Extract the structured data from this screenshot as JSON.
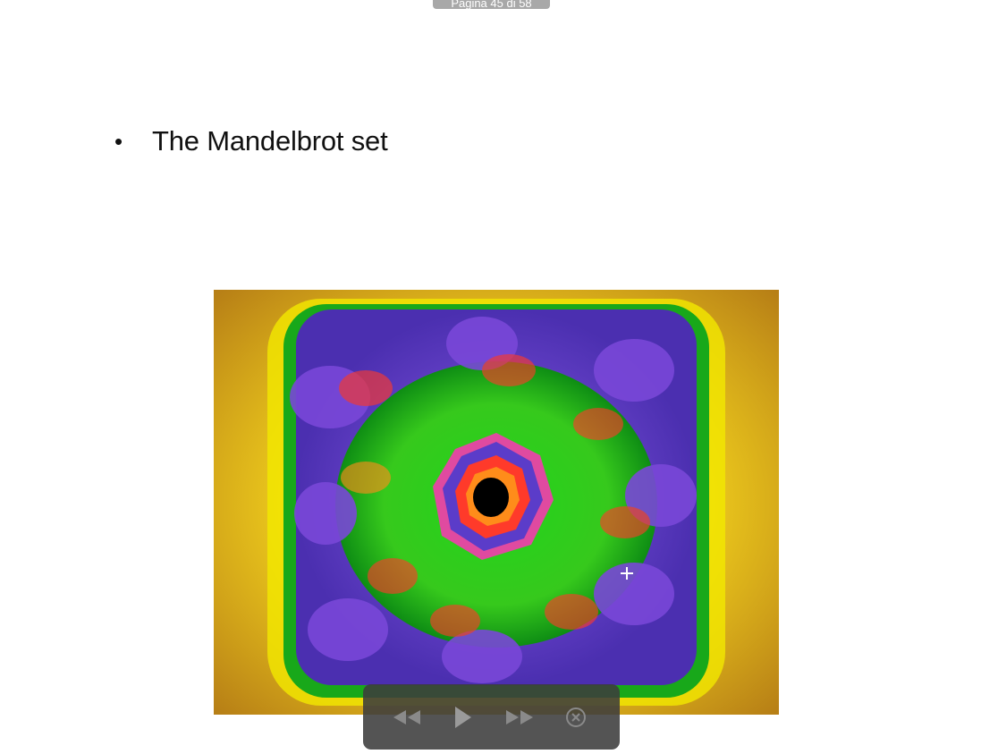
{
  "presentation": {
    "page_indicator": "Pagina 45 di 58",
    "bullet_symbol": "•",
    "bullet_text": "The Mandelbrot set"
  },
  "image": {
    "icon": "mandelbrot-fractal-image",
    "colors": {
      "outer_gold": "#c9951a",
      "yellow": "#f0e400",
      "green": "#22d41c",
      "purple": "#7a48d8",
      "red": "#ff3a2a",
      "orange": "#ff8c1a",
      "black": "#000000"
    }
  },
  "controls": {
    "rewind_icon": "rewind-icon",
    "play_icon": "play-icon",
    "forward_icon": "fast-forward-icon",
    "close_icon": "close-circle-icon",
    "background": "#3c3c3c"
  }
}
